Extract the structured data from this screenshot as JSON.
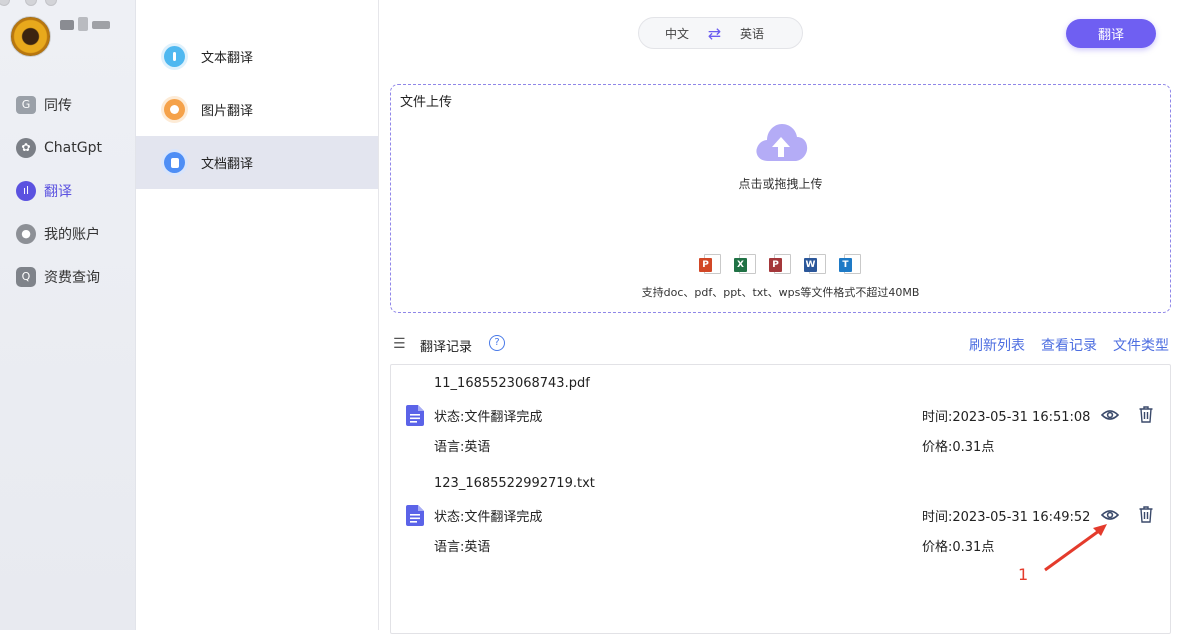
{
  "sidebar": {
    "items": [
      {
        "label": "同传",
        "icon": "translate-card-icon"
      },
      {
        "label": "ChatGpt",
        "icon": "chatgpt-icon"
      },
      {
        "label": "翻译",
        "icon": "voice-wave-icon",
        "active": true
      },
      {
        "label": "我的账户",
        "icon": "user-icon"
      },
      {
        "label": "资费查询",
        "icon": "query-icon"
      }
    ]
  },
  "submenu": {
    "items": [
      {
        "label": "文本翻译",
        "icon": "text-translate-icon",
        "color": "#4fb8f0"
      },
      {
        "label": "图片翻译",
        "icon": "image-translate-icon",
        "color": "#f5a24a"
      },
      {
        "label": "文档翻译",
        "icon": "document-translate-icon",
        "color": "#4e8ef5",
        "active": true
      }
    ]
  },
  "header": {
    "source_lang": "中文",
    "target_lang": "英语",
    "translate_label": "翻译"
  },
  "upload": {
    "title": "文件上传",
    "hint": "点击或拖拽上传",
    "support": "支持doc、pdf、ppt、txt、wps等文件格式不超过40MB",
    "file_types": [
      {
        "tag": "P",
        "color": "#d24726",
        "icon": "powerpoint-icon"
      },
      {
        "tag": "X",
        "color": "#207245",
        "icon": "excel-icon"
      },
      {
        "tag": "P",
        "color": "#a4373a",
        "icon": "pdf-icon"
      },
      {
        "tag": "W",
        "color": "#2b579a",
        "icon": "word-icon"
      },
      {
        "tag": "T",
        "color": "#1e7ac6",
        "icon": "txt-icon"
      }
    ]
  },
  "records": {
    "title": "翻译记录",
    "help": "?",
    "links": [
      "刷新列表",
      "查看记录",
      "文件类型"
    ],
    "items": [
      {
        "filename": "11_1685523068743.pdf",
        "status": "状态:文件翻译完成",
        "language": "语言:英语",
        "time": "时间:2023-05-31 16:51:08",
        "price": "价格:0.31点"
      },
      {
        "filename": "123_1685522992719.txt",
        "status": "状态:文件翻译完成",
        "language": "语言:英语",
        "time": "时间:2023-05-31 16:49:52",
        "price": "价格:0.31点"
      }
    ]
  },
  "annotation": {
    "label": "1",
    "color": "#e43b2c"
  },
  "colors": {
    "accent": "#6f5ff2",
    "link": "#4d6ee0"
  }
}
